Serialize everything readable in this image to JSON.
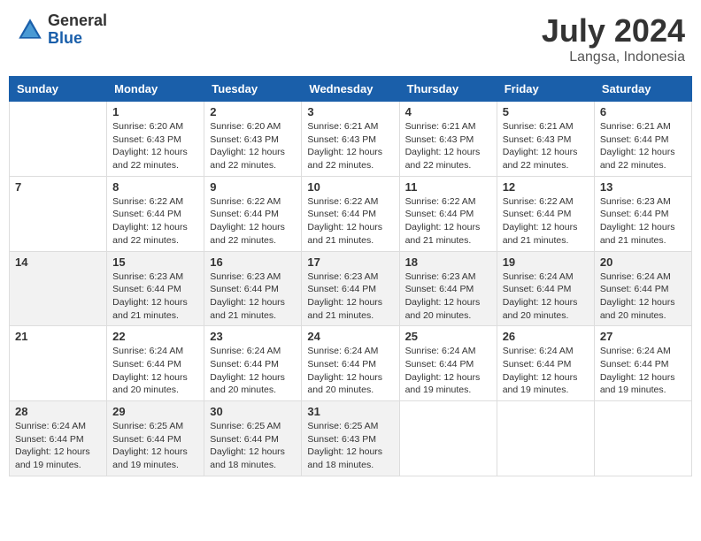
{
  "header": {
    "logo_general": "General",
    "logo_blue": "Blue",
    "month_year": "July 2024",
    "location": "Langsa, Indonesia"
  },
  "weekdays": [
    "Sunday",
    "Monday",
    "Tuesday",
    "Wednesday",
    "Thursday",
    "Friday",
    "Saturday"
  ],
  "weeks": [
    [
      {
        "day": "",
        "info": ""
      },
      {
        "day": "1",
        "info": "Sunrise: 6:20 AM\nSunset: 6:43 PM\nDaylight: 12 hours\nand 22 minutes."
      },
      {
        "day": "2",
        "info": "Sunrise: 6:20 AM\nSunset: 6:43 PM\nDaylight: 12 hours\nand 22 minutes."
      },
      {
        "day": "3",
        "info": "Sunrise: 6:21 AM\nSunset: 6:43 PM\nDaylight: 12 hours\nand 22 minutes."
      },
      {
        "day": "4",
        "info": "Sunrise: 6:21 AM\nSunset: 6:43 PM\nDaylight: 12 hours\nand 22 minutes."
      },
      {
        "day": "5",
        "info": "Sunrise: 6:21 AM\nSunset: 6:43 PM\nDaylight: 12 hours\nand 22 minutes."
      },
      {
        "day": "6",
        "info": "Sunrise: 6:21 AM\nSunset: 6:44 PM\nDaylight: 12 hours\nand 22 minutes."
      }
    ],
    [
      {
        "day": "7",
        "info": ""
      },
      {
        "day": "8",
        "info": "Sunrise: 6:22 AM\nSunset: 6:44 PM\nDaylight: 12 hours\nand 22 minutes."
      },
      {
        "day": "9",
        "info": "Sunrise: 6:22 AM\nSunset: 6:44 PM\nDaylight: 12 hours\nand 22 minutes."
      },
      {
        "day": "10",
        "info": "Sunrise: 6:22 AM\nSunset: 6:44 PM\nDaylight: 12 hours\nand 21 minutes."
      },
      {
        "day": "11",
        "info": "Sunrise: 6:22 AM\nSunset: 6:44 PM\nDaylight: 12 hours\nand 21 minutes."
      },
      {
        "day": "12",
        "info": "Sunrise: 6:22 AM\nSunset: 6:44 PM\nDaylight: 12 hours\nand 21 minutes."
      },
      {
        "day": "13",
        "info": "Sunrise: 6:23 AM\nSunset: 6:44 PM\nDaylight: 12 hours\nand 21 minutes."
      }
    ],
    [
      {
        "day": "14",
        "info": ""
      },
      {
        "day": "15",
        "info": "Sunrise: 6:23 AM\nSunset: 6:44 PM\nDaylight: 12 hours\nand 21 minutes."
      },
      {
        "day": "16",
        "info": "Sunrise: 6:23 AM\nSunset: 6:44 PM\nDaylight: 12 hours\nand 21 minutes."
      },
      {
        "day": "17",
        "info": "Sunrise: 6:23 AM\nSunset: 6:44 PM\nDaylight: 12 hours\nand 21 minutes."
      },
      {
        "day": "18",
        "info": "Sunrise: 6:23 AM\nSunset: 6:44 PM\nDaylight: 12 hours\nand 20 minutes."
      },
      {
        "day": "19",
        "info": "Sunrise: 6:24 AM\nSunset: 6:44 PM\nDaylight: 12 hours\nand 20 minutes."
      },
      {
        "day": "20",
        "info": "Sunrise: 6:24 AM\nSunset: 6:44 PM\nDaylight: 12 hours\nand 20 minutes."
      }
    ],
    [
      {
        "day": "21",
        "info": ""
      },
      {
        "day": "22",
        "info": "Sunrise: 6:24 AM\nSunset: 6:44 PM\nDaylight: 12 hours\nand 20 minutes."
      },
      {
        "day": "23",
        "info": "Sunrise: 6:24 AM\nSunset: 6:44 PM\nDaylight: 12 hours\nand 20 minutes."
      },
      {
        "day": "24",
        "info": "Sunrise: 6:24 AM\nSunset: 6:44 PM\nDaylight: 12 hours\nand 20 minutes."
      },
      {
        "day": "25",
        "info": "Sunrise: 6:24 AM\nSunset: 6:44 PM\nDaylight: 12 hours\nand 19 minutes."
      },
      {
        "day": "26",
        "info": "Sunrise: 6:24 AM\nSunset: 6:44 PM\nDaylight: 12 hours\nand 19 minutes."
      },
      {
        "day": "27",
        "info": "Sunrise: 6:24 AM\nSunset: 6:44 PM\nDaylight: 12 hours\nand 19 minutes."
      }
    ],
    [
      {
        "day": "28",
        "info": "Sunrise: 6:24 AM\nSunset: 6:44 PM\nDaylight: 12 hours\nand 19 minutes."
      },
      {
        "day": "29",
        "info": "Sunrise: 6:25 AM\nSunset: 6:44 PM\nDaylight: 12 hours\nand 19 minutes."
      },
      {
        "day": "30",
        "info": "Sunrise: 6:25 AM\nSunset: 6:44 PM\nDaylight: 12 hours\nand 18 minutes."
      },
      {
        "day": "31",
        "info": "Sunrise: 6:25 AM\nSunset: 6:43 PM\nDaylight: 12 hours\nand 18 minutes."
      },
      {
        "day": "",
        "info": ""
      },
      {
        "day": "",
        "info": ""
      },
      {
        "day": "",
        "info": ""
      }
    ]
  ]
}
